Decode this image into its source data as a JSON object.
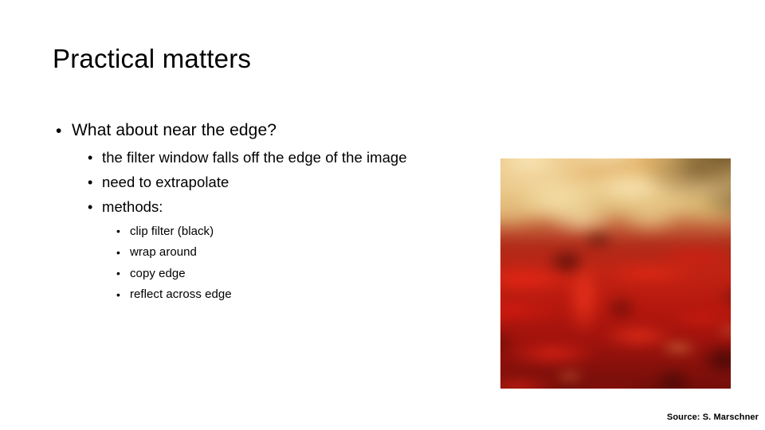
{
  "slide": {
    "title": "Practical matters",
    "background_color": "#ffffff",
    "text_color": "#000000"
  },
  "bullets": {
    "level1": [
      {
        "mark": "•",
        "text": "What about near the edge?"
      }
    ],
    "level2": [
      {
        "mark": "•",
        "text": "the filter window falls off the edge of the image"
      },
      {
        "mark": "•",
        "text": "need to extrapolate"
      },
      {
        "mark": "•",
        "text": "methods:"
      }
    ],
    "level3": [
      {
        "mark": "•",
        "text": "clip filter (black)"
      },
      {
        "mark": "•",
        "text": "wrap around"
      },
      {
        "mark": "•",
        "text": "copy edge"
      },
      {
        "mark": "•",
        "text": "reflect across edge"
      }
    ]
  },
  "figure": {
    "alt": "blurred photograph of red chili peppers on straw",
    "palette": {
      "straw_light": "#f7e2aa",
      "straw_gold": "#d99a4a",
      "olive_dark": "#5c4622",
      "pepper_bright": "#e8261 6",
      "pepper_red": "#c02212",
      "pepper_dark": "#5e0a07"
    }
  },
  "credit": {
    "text": "Source: S. Marschner"
  }
}
